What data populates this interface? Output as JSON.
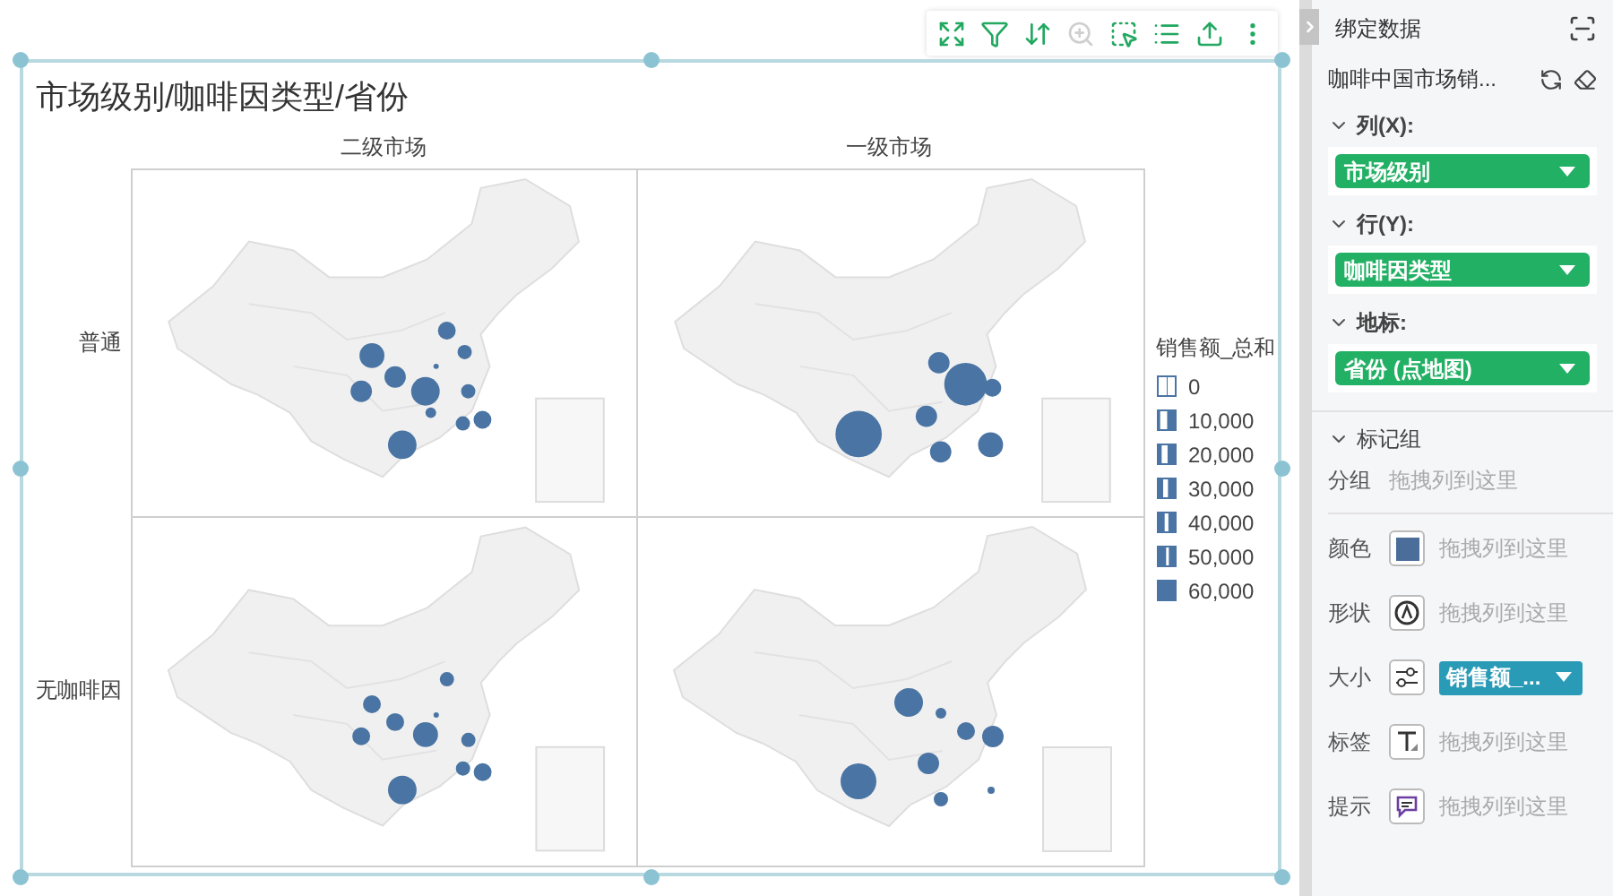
{
  "toolbar": [
    {
      "kind": "expand",
      "disabled": false
    },
    {
      "kind": "filter",
      "disabled": false
    },
    {
      "kind": "swap",
      "disabled": false
    },
    {
      "kind": "zoom",
      "disabled": true
    },
    {
      "kind": "select",
      "disabled": false
    },
    {
      "kind": "list",
      "disabled": false
    },
    {
      "kind": "export",
      "disabled": false
    },
    {
      "kind": "more",
      "disabled": false
    }
  ],
  "chart": {
    "title": "市场级别/咖啡因类型/省份",
    "columns": [
      "二级市场",
      "一级市场"
    ],
    "rows": [
      "普通",
      "无咖啡因"
    ],
    "legend": {
      "title": "销售额_总和",
      "items": [
        {
          "label": "0"
        },
        {
          "label": "10,000"
        },
        {
          "label": "20,000"
        },
        {
          "label": "30,000"
        },
        {
          "label": "40,000"
        },
        {
          "label": "50,000"
        },
        {
          "label": "60,000"
        }
      ]
    }
  },
  "panel": {
    "header": "绑定数据",
    "dataset": "咖啡中国市场销...",
    "shelves": [
      {
        "label": "列(X):",
        "expanded": true,
        "pill": "市场级别"
      },
      {
        "label": "行(Y):",
        "expanded": true,
        "pill": "咖啡因类型"
      },
      {
        "label": "地标:",
        "expanded": true,
        "pill": "省份 (点地图)"
      }
    ],
    "marks": {
      "label": "标记组",
      "expanded": true,
      "group_label": "分组",
      "group_placeholder": "拖拽列到这里",
      "channels": [
        {
          "label": "颜色",
          "kind": "color",
          "placeholder": "拖拽列到这里"
        },
        {
          "label": "形状",
          "kind": "shape",
          "placeholder": "拖拽列到这里"
        },
        {
          "label": "大小",
          "kind": "size",
          "pill": "销售额_..."
        },
        {
          "label": "标签",
          "kind": "label",
          "placeholder": "拖拽列到这里"
        },
        {
          "label": "提示",
          "kind": "tooltip",
          "placeholder": "拖拽列到这里"
        }
      ]
    }
  }
}
